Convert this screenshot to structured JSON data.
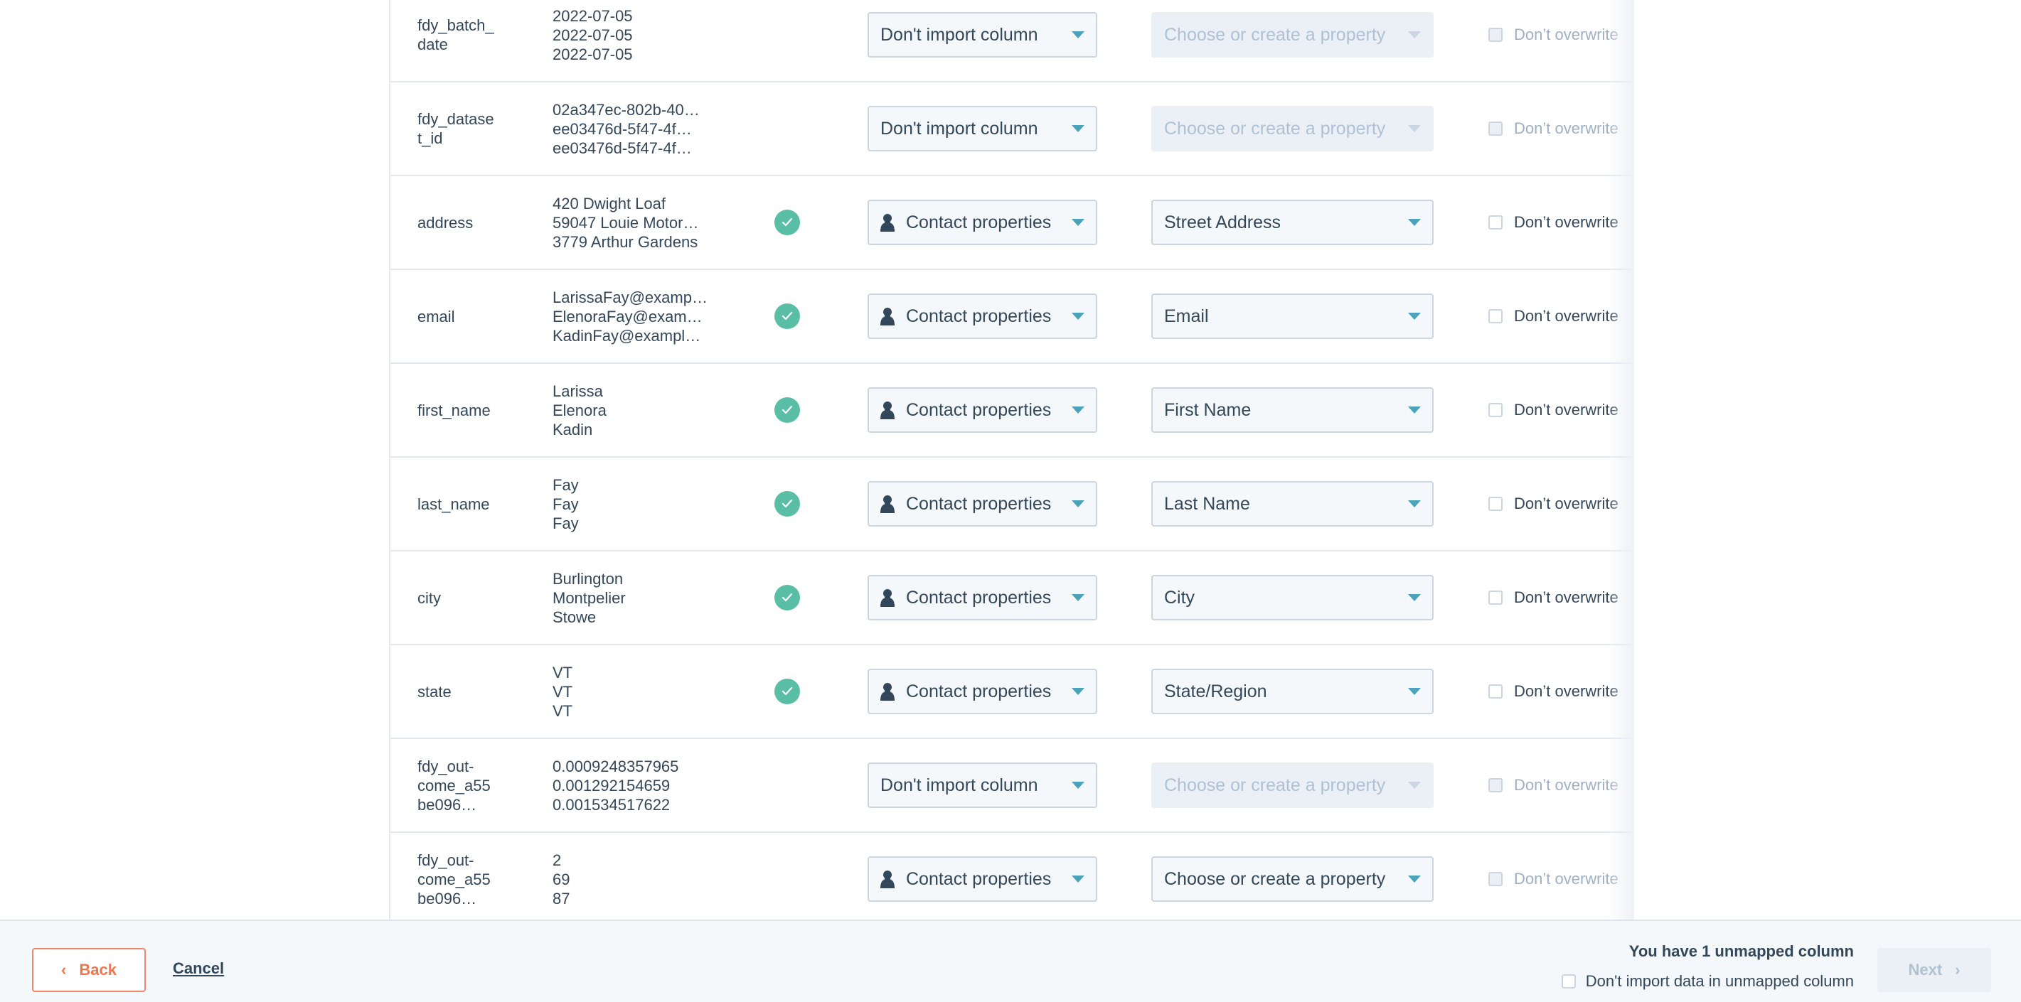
{
  "rows": [
    {
      "column_name": "fdy_batch_\ndate",
      "samples": [
        "2022-07-05",
        "2022-07-05",
        "2022-07-05"
      ],
      "mapped": false,
      "import_as": "Don't import column",
      "import_as_icon": "",
      "property": "Choose or create a property",
      "property_disabled": true,
      "overwrite_label": "Don’t overwrite",
      "overwrite_disabled": true
    },
    {
      "column_name": "fdy_datase\nt_id",
      "samples": [
        "02a347ec-802b-40…",
        "ee03476d-5f47-4f…",
        "ee03476d-5f47-4f…"
      ],
      "mapped": false,
      "import_as": "Don't import column",
      "import_as_icon": "",
      "property": "Choose or create a property",
      "property_disabled": true,
      "overwrite_label": "Don’t overwrite",
      "overwrite_disabled": true
    },
    {
      "column_name": "address",
      "samples": [
        "420 Dwight Loaf",
        "59047 Louie Motor…",
        "3779 Arthur Gardens"
      ],
      "mapped": true,
      "import_as": "Contact properties",
      "import_as_icon": "person-icon",
      "property": "Street Address",
      "property_disabled": false,
      "overwrite_label": "Don’t overwrite",
      "overwrite_disabled": false
    },
    {
      "column_name": "email",
      "samples": [
        "LarissaFay@examp…",
        "ElenoraFay@exam…",
        "KadinFay@exampl…"
      ],
      "mapped": true,
      "import_as": "Contact properties",
      "import_as_icon": "person-icon",
      "property": "Email",
      "property_disabled": false,
      "overwrite_label": "Don’t overwrite",
      "overwrite_disabled": false
    },
    {
      "column_name": "first_name",
      "samples": [
        "Larissa",
        "Elenora",
        "Kadin"
      ],
      "mapped": true,
      "import_as": "Contact properties",
      "import_as_icon": "person-icon",
      "property": "First Name",
      "property_disabled": false,
      "overwrite_label": "Don’t overwrite",
      "overwrite_disabled": false
    },
    {
      "column_name": "last_name",
      "samples": [
        "Fay",
        "Fay",
        "Fay"
      ],
      "mapped": true,
      "import_as": "Contact properties",
      "import_as_icon": "person-icon",
      "property": "Last Name",
      "property_disabled": false,
      "overwrite_label": "Don’t overwrite",
      "overwrite_disabled": false
    },
    {
      "column_name": "city",
      "samples": [
        "Burlington",
        "Montpelier",
        "Stowe"
      ],
      "mapped": true,
      "import_as": "Contact properties",
      "import_as_icon": "person-icon",
      "property": "City",
      "property_disabled": false,
      "overwrite_label": "Don’t overwrite",
      "overwrite_disabled": false
    },
    {
      "column_name": "state",
      "samples": [
        "VT",
        "VT",
        "VT"
      ],
      "mapped": true,
      "import_as": "Contact properties",
      "import_as_icon": "person-icon",
      "property": "State/Region",
      "property_disabled": false,
      "overwrite_label": "Don’t overwrite",
      "overwrite_disabled": false
    },
    {
      "column_name": "fdy_out-\ncome_a55\nbe096…",
      "samples": [
        "0.0009248357965",
        "0.001292154659",
        "0.001534517622"
      ],
      "mapped": false,
      "import_as": "Don't import column",
      "import_as_icon": "",
      "property": "Choose or create a property",
      "property_disabled": true,
      "overwrite_label": "Don’t overwrite",
      "overwrite_disabled": true
    },
    {
      "column_name": "fdy_out-\ncome_a55\nbe096…",
      "samples": [
        "2",
        "69",
        "87"
      ],
      "mapped": false,
      "import_as": "Contact properties",
      "import_as_icon": "person-icon",
      "property": "Choose or create a property",
      "property_disabled": false,
      "overwrite_label": "Don’t overwrite",
      "overwrite_disabled": true
    }
  ],
  "footer": {
    "back_label": "Back",
    "cancel_label": "Cancel",
    "unmapped_message": "You have 1 unmapped column",
    "skip_unmapped_label": "Don't import data in unmapped column",
    "skip_unmapped_checked": false,
    "next_label": "Next",
    "next_disabled": true
  },
  "colors": {
    "accent_teal": "#4aa3b8",
    "success_green": "#5abea6",
    "back_orange": "#f2754c",
    "text_dark": "#33475b",
    "disabled_text": "#b0c1d4"
  }
}
